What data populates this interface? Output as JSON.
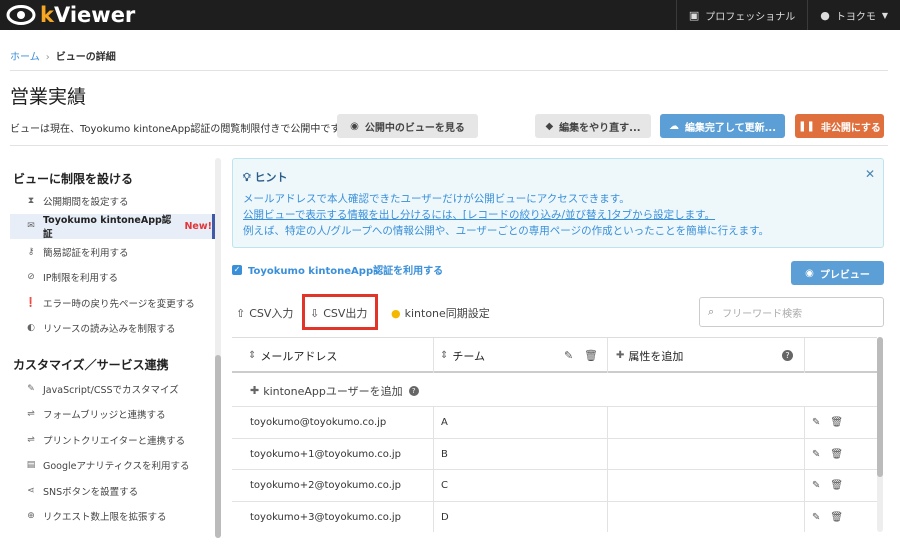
{
  "app": {
    "name_prefix": "k",
    "name_rest": "Viewer"
  },
  "topbar": {
    "plan_label": "プロフェッショナル",
    "user_label": "トヨクモ"
  },
  "breadcrumb": {
    "home": "ホーム",
    "separator": "›",
    "current": "ビューの詳細"
  },
  "page": {
    "title": "営業実績",
    "status_text": "ビューは現在、Toyokumo kintoneApp認証の閲覧制限付きで公開中です"
  },
  "actions": {
    "view_public": "公開中のビューを見る",
    "redo_edit": "編集をやり直す...",
    "finish_update": "編集完了して更新...",
    "unpublish": "非公開にする"
  },
  "sidebar": {
    "sections": [
      {
        "title": "ビューに制限を設ける",
        "items": [
          {
            "label": "公開期間を設定する",
            "icon": "hourglass-icon"
          },
          {
            "label": "Toyokumo kintoneApp認証",
            "icon": "envelope-icon",
            "badge": "New!",
            "active": true
          },
          {
            "label": "簡易認証を利用する",
            "icon": "key-icon"
          },
          {
            "label": "IP制限を利用する",
            "icon": "ban-icon"
          },
          {
            "label": "エラー時の戻り先ページを変更する",
            "icon": "alert-icon"
          },
          {
            "label": "リソースの読み込みを制限する",
            "icon": "shield-icon"
          }
        ]
      },
      {
        "title": "カスタマイズ／サービス連携",
        "items": [
          {
            "label": "JavaScript/CSSでカスタマイズ",
            "icon": "wrench-icon"
          },
          {
            "label": "フォームブリッジと連携する",
            "icon": "link-icon"
          },
          {
            "label": "プリントクリエイターと連携する",
            "icon": "link-icon"
          },
          {
            "label": "Googleアナリティクスを利用する",
            "icon": "chart-icon"
          },
          {
            "label": "SNSボタンを設置する",
            "icon": "share-icon"
          },
          {
            "label": "リクエスト数上限を拡張する",
            "icon": "globe-icon"
          }
        ]
      }
    ]
  },
  "hint": {
    "title": "ヒント",
    "line1": "メールアドレスで本人確認できたユーザーだけが公開ビューにアクセスできます。",
    "line2": "公開ビューで表示する情報を出し分けるには、[レコードの絞り込み/並び替え]タブから設定します。",
    "line3": "例えば、特定の人/グループへの情報公開や、ユーザーごとの専用ページの作成といったことを簡単に行えます。"
  },
  "auth_toggle": {
    "label": "Toyokumo kintoneApp認証を利用する",
    "checked": true
  },
  "preview_button": "プレビュー",
  "toolbar": {
    "csv_in": "CSV入力",
    "csv_out": "CSV出力",
    "kintone_sync": "kintone同期設定"
  },
  "search": {
    "placeholder": "フリーワード検索"
  },
  "table": {
    "col_email": "メールアドレス",
    "col_team": "チーム",
    "add_attribute": "属性を追加",
    "add_user": "kintoneAppユーザーを追加",
    "rows": [
      {
        "email": "toyokumo@toyokumo.co.jp",
        "team": "A"
      },
      {
        "email": "toyokumo+1@toyokumo.co.jp",
        "team": "B"
      },
      {
        "email": "toyokumo+2@toyokumo.co.jp",
        "team": "C"
      },
      {
        "email": "toyokumo+3@toyokumo.co.jp",
        "team": "D"
      }
    ]
  },
  "colors": {
    "accent": "#3a8fd9",
    "orange": "#e06f3e",
    "highlight": "#e2352a",
    "topbar": "#1e1e1e"
  }
}
